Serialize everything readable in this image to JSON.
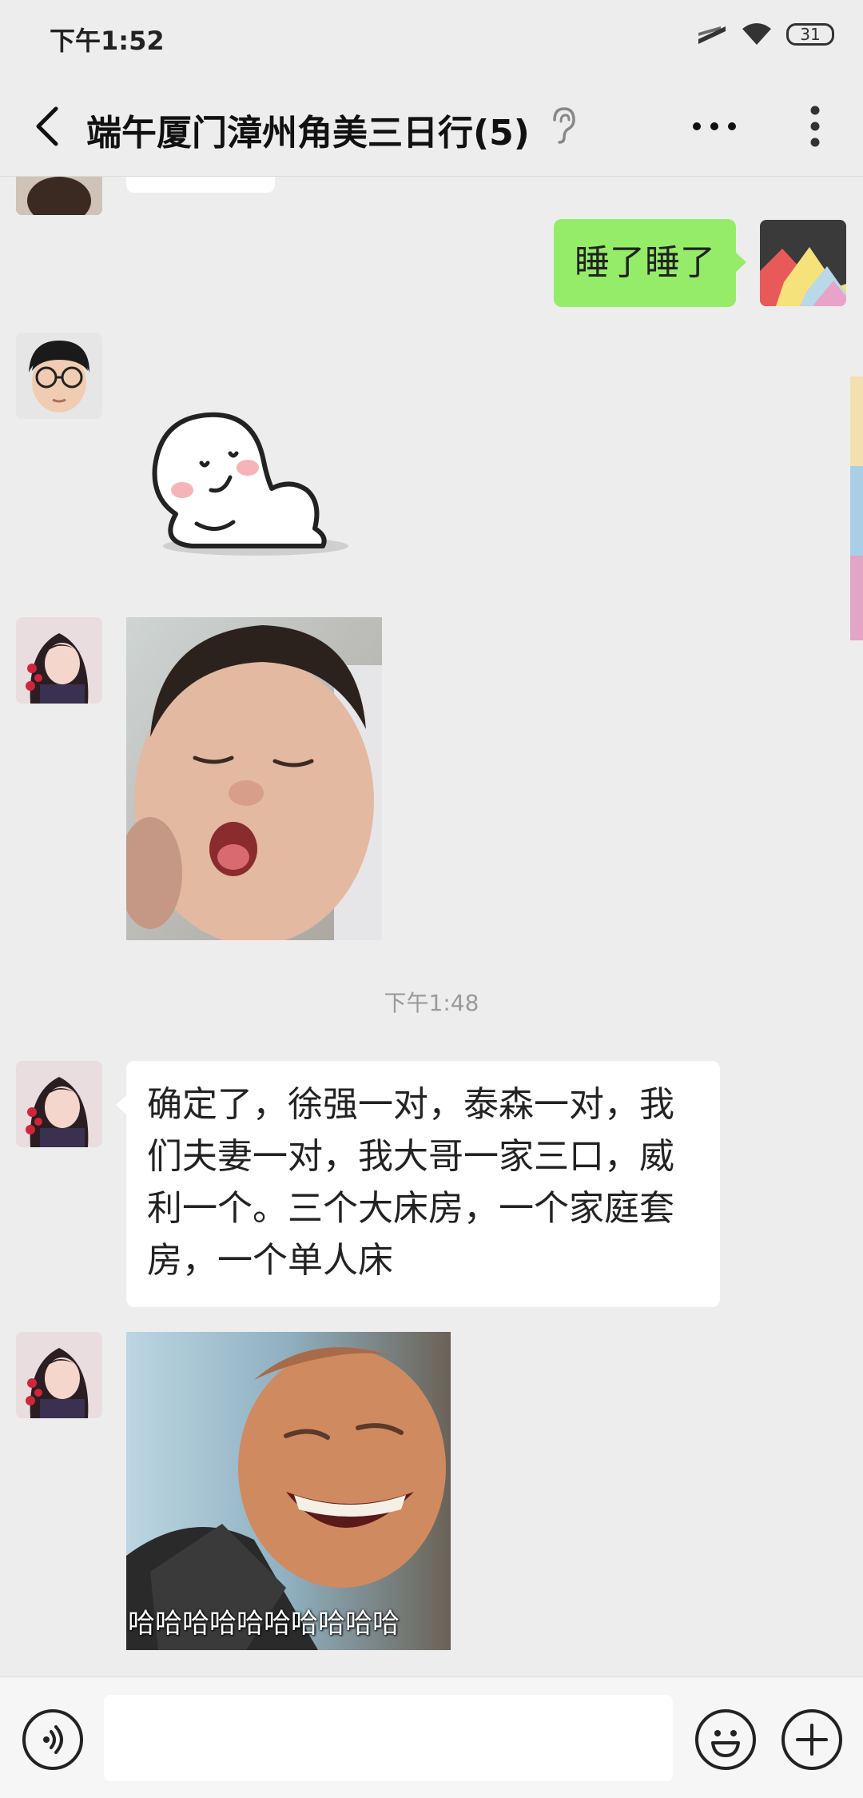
{
  "status_bar": {
    "time": "下午1:52",
    "battery": "31",
    "icons": [
      "signal-icon",
      "wifi-icon",
      "battery-icon"
    ]
  },
  "header": {
    "title": "端午厦门漳州角美三日行(5)",
    "back_icon": "back-arrow-icon",
    "ear_icon": "ear-icon",
    "more_icon": "more-horizontal-icon",
    "menu_icon": "more-vertical-icon"
  },
  "messages": [
    {
      "type": "text",
      "side": "right",
      "text": "睡了睡了"
    },
    {
      "type": "sticker",
      "side": "left",
      "sticker": "white-blob-lying-sticker"
    },
    {
      "type": "image",
      "side": "left",
      "image": "sleeping-baby-yawning-photo"
    },
    {
      "type": "timestamp",
      "text": "下午1:48"
    },
    {
      "type": "text",
      "side": "left",
      "text": "确定了，徐强一对，泰森一对，我们夫妻一对，我大哥一家三口，威利一个。三个大床房，一个家庭套房，一个单人床"
    },
    {
      "type": "image",
      "side": "left",
      "image": "laughing-man-gif",
      "caption": "哈哈哈哈哈哈哈哈哈哈"
    }
  ],
  "input_bar": {
    "voice_icon": "voice-icon",
    "input_value": "",
    "emoji_icon": "emoji-icon",
    "plus_icon": "plus-icon"
  },
  "colors": {
    "background": "#EDEDED",
    "bubble_self": "#95EC69",
    "bubble_other": "#FFFFFF",
    "timestamp": "#9A9A9A"
  }
}
